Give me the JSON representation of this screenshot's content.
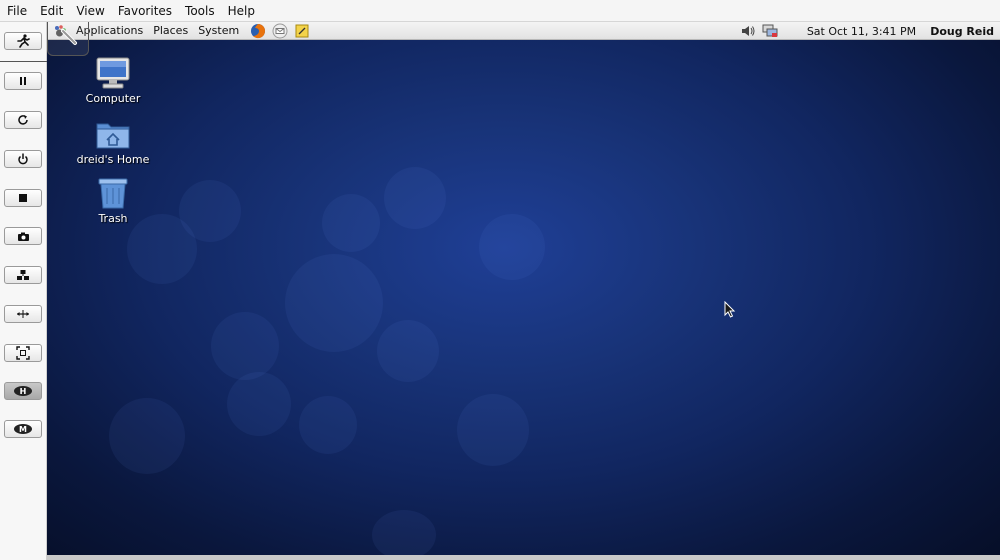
{
  "host_menu": [
    "File",
    "Edit",
    "View",
    "Favorites",
    "Tools",
    "Help"
  ],
  "toolbar": [
    {
      "name": "send-ctrl-alt-del-button",
      "icon": "running-man-icon"
    },
    {
      "name": "pause-button",
      "icon": "pause-icon"
    },
    {
      "name": "refresh-button",
      "icon": "refresh-icon"
    },
    {
      "name": "power-button",
      "icon": "power-icon"
    },
    {
      "name": "stop-button",
      "icon": "stop-icon"
    },
    {
      "name": "snapshot-button",
      "icon": "camera-icon"
    },
    {
      "name": "network-button",
      "icon": "network-icon"
    },
    {
      "name": "resize-button",
      "icon": "resize-icon"
    },
    {
      "name": "fullscreen-button",
      "icon": "fullscreen-icon"
    },
    {
      "name": "h-button",
      "icon": "h-icon",
      "label": "H"
    },
    {
      "name": "m-button",
      "icon": "m-icon",
      "label": "M"
    }
  ],
  "panel": {
    "menus": [
      "Applications",
      "Places",
      "System"
    ],
    "clock": "Sat Oct 11,  3:41 PM",
    "user": "Doug Reid"
  },
  "desktop": {
    "icons": [
      {
        "label": "Computer",
        "icon": "computer-icon"
      },
      {
        "label": "dreid's Home",
        "icon": "home-folder-icon"
      },
      {
        "label": "Trash",
        "icon": "trash-icon"
      }
    ]
  },
  "colors": {
    "desktop_center": "#1f3f96",
    "desktop_edge": "#060e27",
    "panel": "#e8e8e8"
  }
}
